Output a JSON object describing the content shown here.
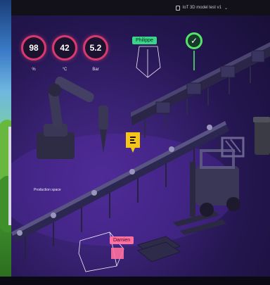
{
  "toolbar": {
    "model_label": "IoT 3D model test v1"
  },
  "gauges": [
    {
      "value": "98",
      "unit": "%"
    },
    {
      "value": "42",
      "unit": "°C"
    },
    {
      "value": "5.2",
      "unit": "Bar"
    }
  ],
  "tags": {
    "philippe": "Philippe",
    "damien": "Damien"
  },
  "scene": {
    "caption": "Production space"
  },
  "colors": {
    "accent_pink": "#d8396e",
    "ok_green": "#55e36a",
    "tag_green": "#3ad48a",
    "tag_pink": "#ff6fa0",
    "marker_yellow": "#f5c518",
    "scene_purple": "#36206e"
  }
}
